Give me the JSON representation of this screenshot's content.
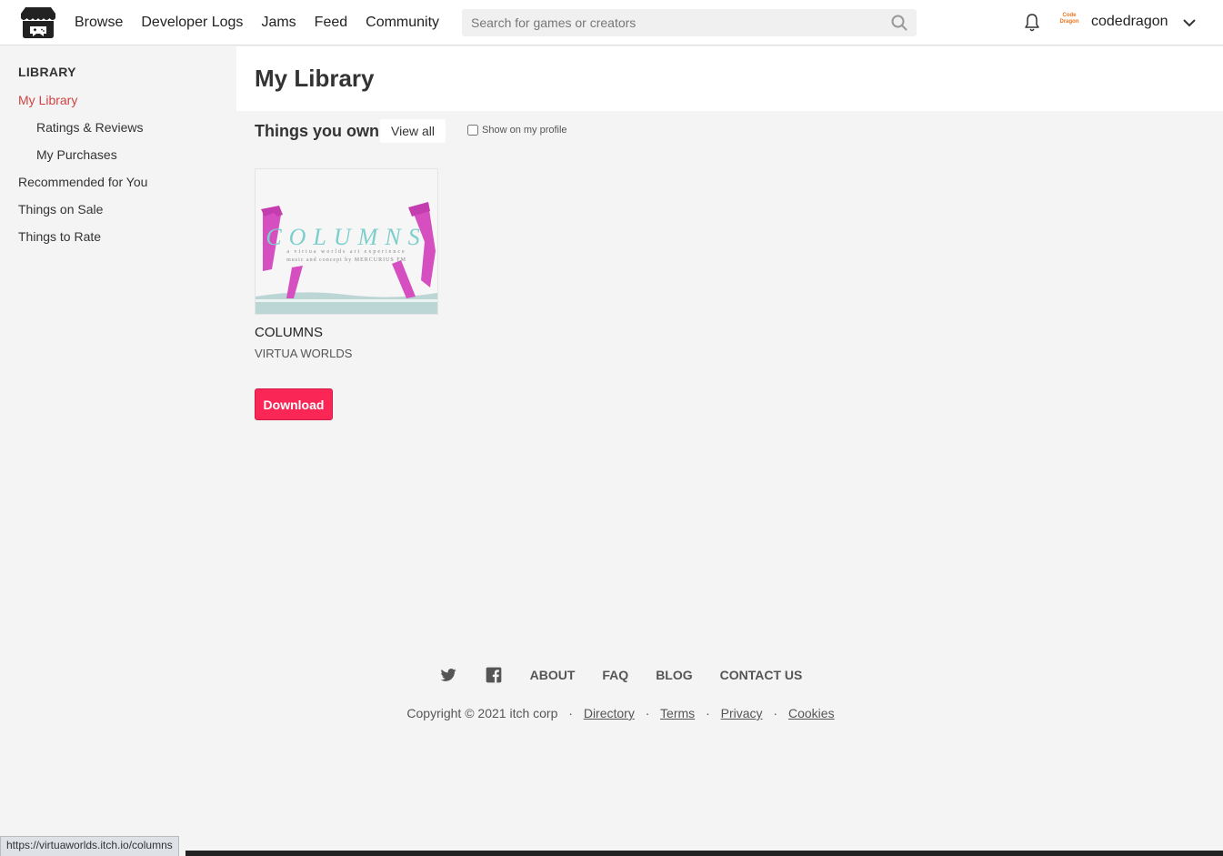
{
  "header": {
    "nav": [
      "Browse",
      "Developer Logs",
      "Jams",
      "Feed",
      "Community"
    ],
    "search_placeholder": "Search for games or creators",
    "avatar_text": "Code Dragon",
    "username": "codedragon",
    "icons": [
      "itchio-logo-icon",
      "search-icon",
      "bell-icon",
      "chevron-down-icon"
    ]
  },
  "sidebar": {
    "title": "LIBRARY",
    "items": [
      {
        "label": "My Library",
        "active": true
      },
      {
        "label": "Ratings & Reviews"
      },
      {
        "label": "My Purchases"
      },
      {
        "label": "Recommended for You"
      },
      {
        "label": "Things on Sale"
      },
      {
        "label": "Things to Rate"
      }
    ]
  },
  "main": {
    "title": "My Library",
    "section_title": "Things you own",
    "view_all": "View all",
    "show_on_profile": "Show on my profile",
    "games": [
      {
        "cover_title": "COLUMNS",
        "cover_sub1": "a virtua worlds art experience",
        "cover_sub2": "music and concept by MERCURIUS FM",
        "title": "COLUMNS",
        "author": "VIRTUA WORLDS",
        "button": "Download"
      }
    ]
  },
  "footer": {
    "links": [
      "ABOUT",
      "FAQ",
      "BLOG",
      "CONTACT US"
    ],
    "copyright": "Copyright © 2021 itch corp",
    "legal": [
      "Directory",
      "Terms",
      "Privacy",
      "Cookies"
    ],
    "separator": "·",
    "icons": [
      "twitter-icon",
      "facebook-icon"
    ]
  },
  "status_url": "https://virtuaworlds.itch.io/columns",
  "colors": {
    "accent": "#fa2655",
    "active_link": "#d14343",
    "cover_text": "#7ecfcc",
    "cover_pillars": "#d64fc0"
  }
}
